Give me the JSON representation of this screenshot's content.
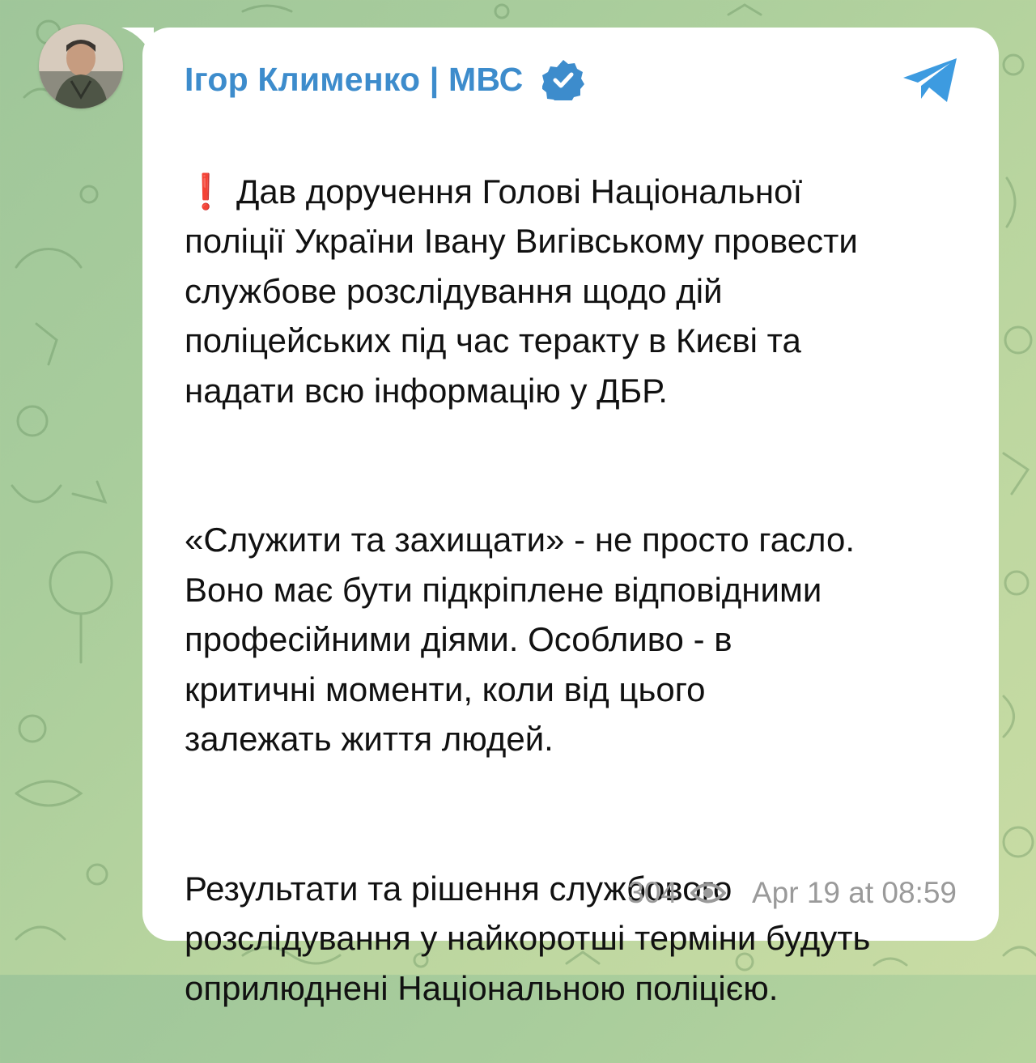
{
  "channel": {
    "name": "Ігор Клименко | МВС",
    "verified_icon": "verified-badge-icon",
    "share_icon": "telegram-share-icon"
  },
  "message": {
    "paragraphs": [
      "❗️ Дав доручення Голові Національної\nполіції України Івану Вигівському провести\nслужбове розслідування щодо дій\nполіцейських під час теракту в Києві та\nнадати всю інформацію у ДБР.",
      "«Служити та захищати» - не просто гасло.\nВоно має бути підкріплене відповідними\nпрофесійними діями. Особливо - в\nкритичні моменти, коли від цього\nзалежать життя людей.",
      "Результати та рішення службового\nрозслідування у найкоротші терміни будуть\nоприлюднені Національною поліцією."
    ],
    "views": "304",
    "timestamp": "Apr 19 at 08:59"
  },
  "colors": {
    "accent": "#3d8ccc",
    "meta": "#9a9a9a",
    "bubble": "#ffffff"
  }
}
